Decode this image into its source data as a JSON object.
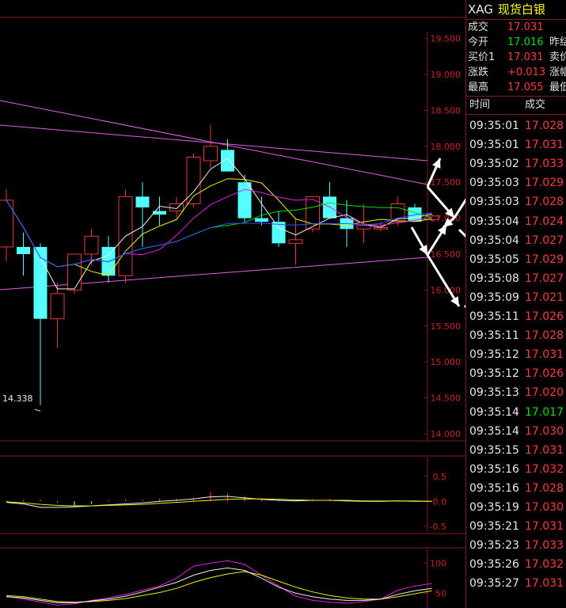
{
  "chart_data": [
    {
      "type": "candlestick",
      "title": "",
      "ylim": [
        13.9,
        19.75
      ],
      "y_ticks": [
        "19.500",
        "19.000",
        "18.500",
        "18.000",
        "17.500",
        "17.000",
        "16.500",
        "16.000",
        "15.500",
        "15.000",
        "14.500",
        "14.000"
      ],
      "low_annotation": "14.338",
      "candles": [
        {
          "o": 16.6,
          "h": 17.4,
          "l": 16.4,
          "c": 17.25
        },
        {
          "o": 16.6,
          "h": 16.8,
          "l": 16.2,
          "c": 16.5
        },
        {
          "o": 16.6,
          "h": 16.65,
          "l": 14.4,
          "c": 15.6
        },
        {
          "o": 15.6,
          "h": 16.1,
          "l": 15.2,
          "c": 15.95
        },
        {
          "o": 16.0,
          "h": 16.5,
          "l": 15.95,
          "c": 16.5
        },
        {
          "o": 16.5,
          "h": 16.85,
          "l": 16.35,
          "c": 16.75
        },
        {
          "o": 16.6,
          "h": 16.75,
          "l": 16.1,
          "c": 16.2
        },
        {
          "o": 16.2,
          "h": 17.4,
          "l": 16.1,
          "c": 17.3
        },
        {
          "o": 17.3,
          "h": 17.5,
          "l": 16.6,
          "c": 17.15
        },
        {
          "o": 17.1,
          "h": 17.3,
          "l": 16.9,
          "c": 17.05
        },
        {
          "o": 17.1,
          "h": 17.3,
          "l": 17.0,
          "c": 17.2
        },
        {
          "o": 17.2,
          "h": 17.9,
          "l": 17.15,
          "c": 17.85
        },
        {
          "o": 17.8,
          "h": 18.3,
          "l": 17.7,
          "c": 18.0
        },
        {
          "o": 17.95,
          "h": 18.1,
          "l": 17.65,
          "c": 17.65
        },
        {
          "o": 17.5,
          "h": 17.6,
          "l": 16.95,
          "c": 17.0
        },
        {
          "o": 17.0,
          "h": 17.3,
          "l": 16.9,
          "c": 16.95
        },
        {
          "o": 16.95,
          "h": 17.1,
          "l": 16.6,
          "c": 16.65
        },
        {
          "o": 16.65,
          "h": 17.0,
          "l": 16.35,
          "c": 16.7
        },
        {
          "o": 16.85,
          "h": 17.3,
          "l": 16.8,
          "c": 17.3
        },
        {
          "o": 17.3,
          "h": 17.5,
          "l": 17.0,
          "c": 17.0
        },
        {
          "o": 17.0,
          "h": 17.25,
          "l": 16.6,
          "c": 16.85
        },
        {
          "o": 16.85,
          "h": 17.2,
          "l": 16.65,
          "c": 16.9
        },
        {
          "o": 16.85,
          "h": 16.95,
          "l": 16.82,
          "c": 16.87
        },
        {
          "o": 16.95,
          "h": 17.3,
          "l": 16.9,
          "c": 17.2
        },
        {
          "o": 17.15,
          "h": 17.2,
          "l": 16.95,
          "c": 16.95
        },
        {
          "o": 16.98,
          "h": 17.05,
          "l": 16.96,
          "c": 17.03
        }
      ]
    },
    {
      "type": "bar",
      "title": "",
      "ylim": [
        -0.55,
        0.75
      ],
      "y_ticks": [
        "0.5",
        "0.0",
        "-0.5"
      ]
    },
    {
      "type": "line",
      "title": "",
      "ylim": [
        20,
        115
      ],
      "y_ticks": [
        "100",
        "50"
      ]
    }
  ],
  "sidebar": {
    "code": "XAG",
    "name": "现货白银",
    "quotes": [
      {
        "label": "成交",
        "value": "17.031",
        "color": "#ff3b3b",
        "label2": ""
      },
      {
        "label": "今开",
        "value": "17.016",
        "color": "#00e000",
        "label2": "昨结"
      },
      {
        "label": "买价1",
        "value": "17.031",
        "color": "#ff3b3b",
        "label2": "卖价"
      },
      {
        "label": "涨跌",
        "value": "+0.013",
        "color": "#ff3b3b",
        "label2": "涨幅"
      },
      {
        "label": "最高",
        "value": "17.055",
        "color": "#ff3b3b",
        "label2": "最低"
      }
    ],
    "tick_header": {
      "time": "时间",
      "price": "成交"
    },
    "ticks": [
      {
        "time": "09:35:01",
        "price": "17.028",
        "color": "#ff3b3b"
      },
      {
        "time": "09:35:01",
        "price": "17.031",
        "color": "#ff3b3b"
      },
      {
        "time": "09:35:02",
        "price": "17.033",
        "color": "#ff3b3b"
      },
      {
        "time": "09:35:03",
        "price": "17.029",
        "color": "#ff3b3b"
      },
      {
        "time": "09:35:03",
        "price": "17.028",
        "color": "#ff3b3b"
      },
      {
        "time": "09:35:04",
        "price": "17.024",
        "color": "#ff3b3b"
      },
      {
        "time": "09:35:04",
        "price": "17.027",
        "color": "#ff3b3b"
      },
      {
        "time": "09:35:05",
        "price": "17.029",
        "color": "#ff3b3b"
      },
      {
        "time": "09:35:08",
        "price": "17.027",
        "color": "#ff3b3b"
      },
      {
        "time": "09:35:09",
        "price": "17.021",
        "color": "#ff3b3b"
      },
      {
        "time": "09:35:11",
        "price": "17.026",
        "color": "#ff3b3b"
      },
      {
        "time": "09:35:11",
        "price": "17.028",
        "color": "#ff3b3b"
      },
      {
        "time": "09:35:12",
        "price": "17.031",
        "color": "#ff3b3b"
      },
      {
        "time": "09:35:12",
        "price": "17.026",
        "color": "#ff3b3b"
      },
      {
        "time": "09:35:13",
        "price": "17.020",
        "color": "#ff3b3b"
      },
      {
        "time": "09:35:14",
        "price": "17.017",
        "color": "#00e000"
      },
      {
        "time": "09:35:14",
        "price": "17.030",
        "color": "#ff3b3b"
      },
      {
        "time": "09:35:15",
        "price": "17.031",
        "color": "#ff3b3b"
      },
      {
        "time": "09:35:16",
        "price": "17.032",
        "color": "#ff3b3b"
      },
      {
        "time": "09:35:16",
        "price": "17.028",
        "color": "#ff3b3b"
      },
      {
        "time": "09:35:19",
        "price": "17.030",
        "color": "#ff3b3b"
      },
      {
        "time": "09:35:21",
        "price": "17.031",
        "color": "#ff3b3b"
      },
      {
        "time": "09:35:23",
        "price": "17.033",
        "color": "#ff3b3b"
      },
      {
        "time": "09:35:26",
        "price": "17.032",
        "color": "#ff3b3b"
      },
      {
        "time": "09:35:27",
        "price": "17.031",
        "color": "#ff3b3b"
      }
    ]
  },
  "colors": {
    "up": "#e83a3a",
    "down": "#54ffff",
    "grid": "#8a1a1a",
    "axis_text": "#cc2222",
    "ma_white": "#f0f0f0",
    "ma_yellow": "#f0f000",
    "ma_magenta": "#e020e0",
    "ma_green": "#00e000",
    "ma_blue": "#3050ff",
    "trend": "#e060e0"
  }
}
